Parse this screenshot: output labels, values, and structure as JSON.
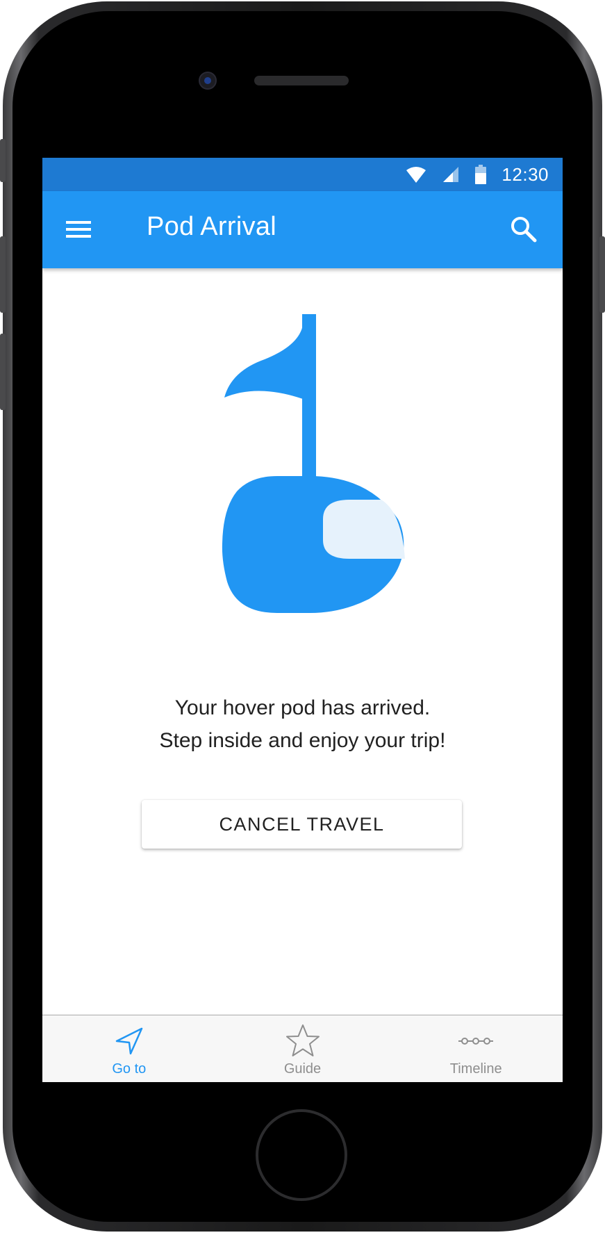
{
  "status_bar": {
    "time": "12:30",
    "icons": [
      "wifi-icon",
      "cellular-signal-icon",
      "battery-icon"
    ]
  },
  "app_bar": {
    "title": "Pod Arrival",
    "left_icon": "menu-icon",
    "right_icon": "search-icon"
  },
  "illustration": {
    "icon": "hover-pod-flag-icon"
  },
  "message": {
    "line1": "Your hover pod has arrived.",
    "line2": "Step inside and enjoy your trip!"
  },
  "actions": {
    "cancel_label": "CANCEL TRAVEL"
  },
  "bottom_nav": {
    "items": [
      {
        "label": "Go to",
        "icon": "navigation-arrow-icon",
        "active": true
      },
      {
        "label": "Guide",
        "icon": "star-icon",
        "active": false
      },
      {
        "label": "Timeline",
        "icon": "timeline-icon",
        "active": false
      }
    ]
  },
  "colors": {
    "primary": "#2196f3",
    "status_bar": "#1e7ad2",
    "pod_window": "#e6f2fc",
    "nav_active": "#2196f3",
    "nav_inactive": "#8e8e8e"
  }
}
